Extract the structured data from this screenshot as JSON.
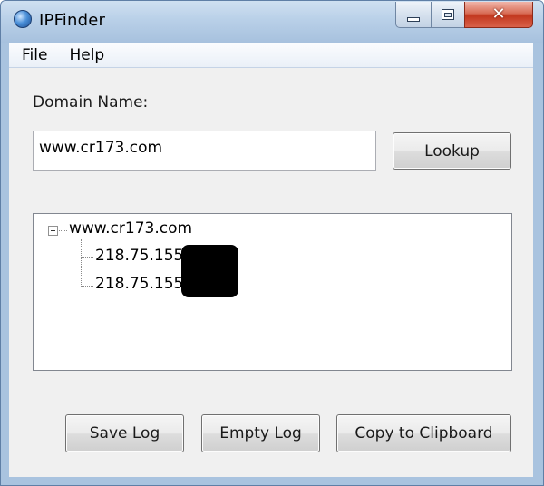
{
  "window": {
    "title": "IPFinder",
    "icon": "globe-icon",
    "controls": {
      "minimize": "minimize-icon",
      "maximize": "maximize-icon",
      "close": "close-icon"
    },
    "close_glyph": "✕"
  },
  "menu": [
    "File",
    "Help"
  ],
  "form": {
    "domain_label": "Domain Name:",
    "domain_value": "www.cr173.com",
    "lookup_label": "Lookup"
  },
  "results": {
    "root": "www.cr173.com",
    "children": [
      "218.75.155",
      "218.75.155"
    ],
    "redacted": true
  },
  "actions": {
    "save_log": "Save Log",
    "empty_log": "Empty Log",
    "copy": "Copy to Clipboard"
  }
}
